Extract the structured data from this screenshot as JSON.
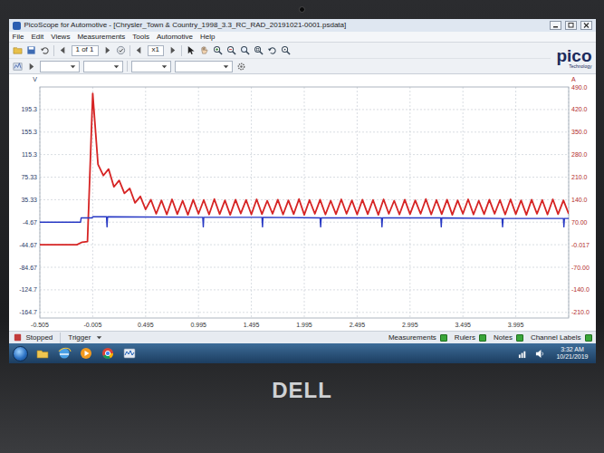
{
  "window": {
    "title": "PicoScope for Automotive - [Chrysler_Town & Country_1998_3.3_RC_RAD_20191021-0001.psdata]"
  },
  "menu": [
    "File",
    "Edit",
    "Views",
    "Measurements",
    "Tools",
    "Automotive",
    "Help"
  ],
  "toolbar": {
    "page": "1 of 1",
    "zoom": "x1",
    "logo": "pico",
    "logo_sub": "Technology"
  },
  "chart": {
    "y_left": {
      "unit": "V",
      "ticks": [
        "195.3",
        "155.3",
        "115.3",
        "75.33",
        "35.33",
        "-4.67",
        "-44.67",
        "-84.67",
        "-124.7",
        "-164.7"
      ]
    },
    "y_right": {
      "unit": "A",
      "ticks": [
        "490.0",
        "420.0",
        "350.0",
        "280.0",
        "210.0",
        "140.0",
        "70.00",
        "-0.017",
        "-70.00",
        "-140.0",
        "-210.0"
      ]
    },
    "x": {
      "ticks": [
        "-0.505",
        "-0.005",
        "0.495",
        "0.995",
        "1.495",
        "1.995",
        "2.495",
        "2.995",
        "3.495",
        "3.995"
      ]
    },
    "series": [
      {
        "kind": "sampled",
        "axis": "right",
        "color": "#d62424",
        "x_start": -0.505,
        "x_step": 0.05,
        "values": [
          0,
          0,
          0,
          0,
          0,
          0,
          0,
          0,
          8,
          10,
          470,
          250,
          215,
          235,
          180,
          200,
          160,
          175,
          130,
          150,
          110,
          140,
          96,
          138,
          94,
          141,
          95,
          137,
          93,
          140,
          96,
          139,
          94,
          142,
          95,
          138,
          93,
          140,
          97,
          139,
          94,
          141,
          95,
          137,
          96,
          140,
          94,
          138,
          95,
          142,
          93,
          139,
          96,
          140,
          94,
          137,
          95,
          141,
          96,
          138,
          94,
          140,
          95,
          139,
          93,
          141,
          96,
          137,
          94,
          140,
          95,
          138,
          96,
          142,
          94,
          139,
          95,
          140,
          93,
          138,
          96,
          141,
          94,
          137,
          95,
          140,
          96,
          139,
          94,
          141,
          95,
          138,
          93,
          140,
          96,
          139,
          94,
          141,
          95,
          138,
          96
        ]
      },
      {
        "kind": "pairs",
        "axis": "left",
        "color": "#2738c4",
        "points": [
          [
            -0.505,
            -4.67
          ],
          [
            -0.12,
            -4.67
          ],
          [
            -0.115,
            3
          ],
          [
            -0.01,
            3
          ],
          [
            -0.005,
            5
          ],
          [
            0.125,
            5
          ],
          [
            0.13,
            -13
          ],
          [
            0.135,
            5
          ],
          [
            1.035,
            4
          ],
          [
            1.04,
            -13
          ],
          [
            1.045,
            4
          ],
          [
            1.595,
            4
          ],
          [
            1.6,
            -13
          ],
          [
            1.605,
            4
          ],
          [
            2.145,
            3
          ],
          [
            2.15,
            -13
          ],
          [
            2.155,
            3
          ],
          [
            2.725,
            3
          ],
          [
            2.73,
            -13
          ],
          [
            2.735,
            3
          ],
          [
            3.285,
            3
          ],
          [
            3.29,
            -13
          ],
          [
            3.295,
            3
          ],
          [
            3.865,
            2
          ],
          [
            3.87,
            -13
          ],
          [
            3.875,
            2
          ],
          [
            4.445,
            2
          ],
          [
            4.45,
            -13
          ],
          [
            4.455,
            2
          ],
          [
            4.495,
            2
          ]
        ]
      }
    ]
  },
  "status_bar": {
    "state": "Stopped",
    "trigger": "Trigger",
    "toggles": [
      {
        "label": "Measurements",
        "on": true
      },
      {
        "label": "Rulers",
        "on": true
      },
      {
        "label": "Notes",
        "on": true
      },
      {
        "label": "Channel Labels",
        "on": true
      }
    ]
  },
  "taskbar": {
    "time": "3:32 AM",
    "date": "10/21/2019"
  },
  "bezel": {
    "brand": "DELL"
  }
}
